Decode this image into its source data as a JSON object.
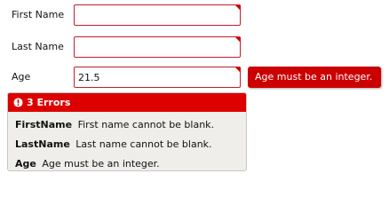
{
  "form": {
    "first_name": {
      "label": "First Name",
      "value": ""
    },
    "last_name": {
      "label": "Last Name",
      "value": ""
    },
    "age": {
      "label": "Age",
      "value": "21.5",
      "error": "Age must be an integer."
    }
  },
  "summary": {
    "header": "3 Errors",
    "items": [
      {
        "field": "FirstName",
        "message": "First name cannot be blank."
      },
      {
        "field": "LastName",
        "message": "Last name cannot be blank."
      },
      {
        "field": "Age",
        "message": "Age must be an integer."
      }
    ]
  },
  "colors": {
    "error_red": "#dc0000",
    "input_border": "#c41e2a",
    "summary_bg": "#efeeea"
  },
  "icons": {
    "summary_header": "alert-circle-icon",
    "invalid_marker": "invalid-corner-icon"
  }
}
